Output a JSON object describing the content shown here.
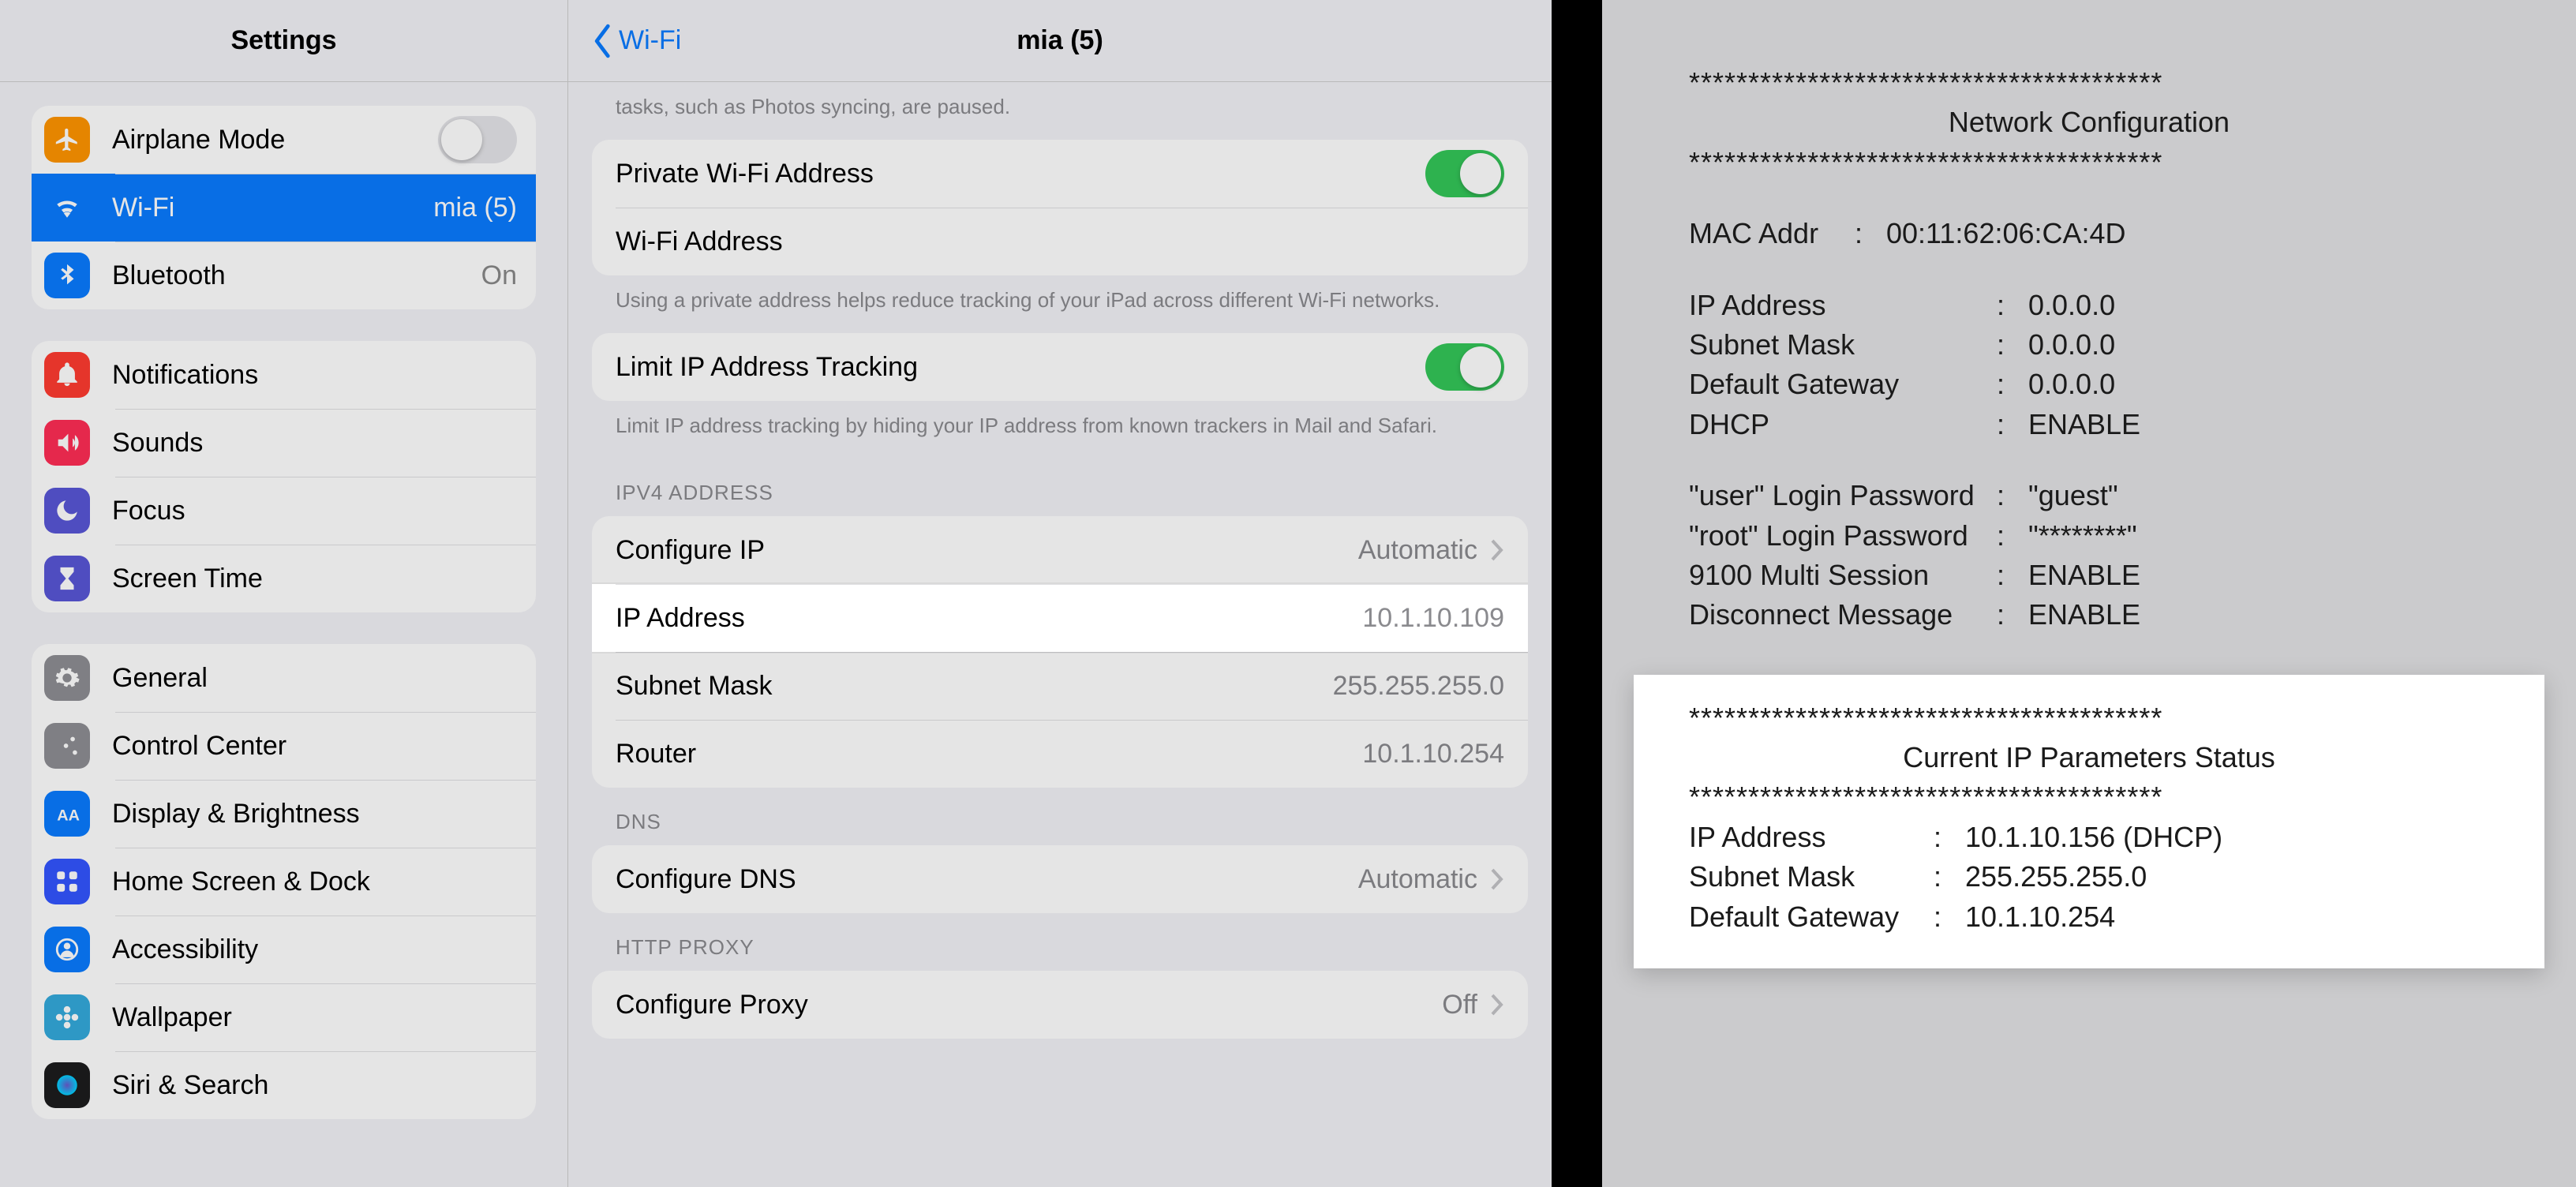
{
  "sidebar": {
    "title": "Settings",
    "groups": [
      {
        "rows": [
          {
            "id": "airplane",
            "label": "Airplane Mode",
            "icon": "airplane",
            "color": "#ff9500",
            "type": "toggle",
            "on": false
          },
          {
            "id": "wifi",
            "label": "Wi-Fi",
            "icon": "wifi",
            "color": "#0a7bff",
            "value": "mia (5)",
            "selected": true
          },
          {
            "id": "bluetooth",
            "label": "Bluetooth",
            "icon": "bluetooth",
            "color": "#0a7bff",
            "value": "On"
          }
        ]
      },
      {
        "rows": [
          {
            "id": "notif",
            "label": "Notifications",
            "icon": "bell",
            "color": "#ff3b30"
          },
          {
            "id": "sounds",
            "label": "Sounds",
            "icon": "speaker",
            "color": "#ff2d55"
          },
          {
            "id": "focus",
            "label": "Focus",
            "icon": "moon",
            "color": "#5856d6"
          },
          {
            "id": "screen",
            "label": "Screen Time",
            "icon": "hourglass",
            "color": "#5856d6"
          }
        ]
      },
      {
        "rows": [
          {
            "id": "general",
            "label": "General",
            "icon": "gear",
            "color": "#8e8e93"
          },
          {
            "id": "cc",
            "label": "Control Center",
            "icon": "sliders",
            "color": "#8e8e93"
          },
          {
            "id": "display",
            "label": "Display & Brightness",
            "icon": "aa",
            "color": "#0a7bff"
          },
          {
            "id": "home",
            "label": "Home Screen & Dock",
            "icon": "grid",
            "color": "#3355ff"
          },
          {
            "id": "access",
            "label": "Accessibility",
            "icon": "person",
            "color": "#0a7bff"
          },
          {
            "id": "wall",
            "label": "Wallpaper",
            "icon": "flower",
            "color": "#34aadc"
          },
          {
            "id": "siri",
            "label": "Siri & Search",
            "icon": "siri",
            "color": "#1c1c1e"
          }
        ]
      }
    ]
  },
  "detail": {
    "back": "Wi-Fi",
    "title": "mia (5)",
    "topHelp": "tasks, such as Photos syncing, are paused.",
    "privateAddress": {
      "label": "Private Wi-Fi Address",
      "on": true
    },
    "wifiAddressRow": {
      "label": "Wi-Fi Address"
    },
    "privateHelp": "Using a private address helps reduce tracking of your iPad across different Wi-Fi networks.",
    "limitTracking": {
      "label": "Limit IP Address Tracking",
      "on": true
    },
    "limitHelp": "Limit IP address tracking by hiding your IP address from known trackers in Mail and Safari.",
    "ipv4Header": "IPV4 ADDRESS",
    "ipv4": {
      "configure": {
        "label": "Configure IP",
        "value": "Automatic"
      },
      "ip": {
        "label": "IP Address",
        "value": "10.1.10.109"
      },
      "mask": {
        "label": "Subnet Mask",
        "value": "255.255.255.0"
      },
      "router": {
        "label": "Router",
        "value": "10.1.10.254"
      }
    },
    "dnsHeader": "DNS",
    "dns": {
      "label": "Configure DNS",
      "value": "Automatic"
    },
    "proxyHeader": "HTTP PROXY",
    "proxy": {
      "label": "Configure Proxy",
      "value": "Off"
    }
  },
  "slip": {
    "stars": "****************************************",
    "title": "Network Configuration",
    "mac": {
      "k": "MAC Addr",
      "v": "00:11:62:06:CA:4D"
    },
    "rows1": [
      {
        "k": "IP Address",
        "v": "0.0.0.0"
      },
      {
        "k": "Subnet Mask",
        "v": "0.0.0.0"
      },
      {
        "k": "Default Gateway",
        "v": "0.0.0.0"
      },
      {
        "k": "DHCP",
        "v": "ENABLE"
      }
    ],
    "rows2": [
      {
        "k": "\"user\" Login Password",
        "v": "\"guest\""
      },
      {
        "k": "\"root\" Login Password",
        "v": "\"********\""
      },
      {
        "k": "9100 Multi Session",
        "v": "ENABLE"
      },
      {
        "k": "Disconnect Message",
        "v": "ENABLE"
      }
    ],
    "title2": "Current IP Parameters Status",
    "rows3": [
      {
        "k": "IP Address",
        "v": "10.1.10.156 (DHCP)"
      },
      {
        "k": "Subnet Mask",
        "v": "255.255.255.0"
      },
      {
        "k": "Default Gateway",
        "v": "10.1.10.254"
      }
    ]
  }
}
